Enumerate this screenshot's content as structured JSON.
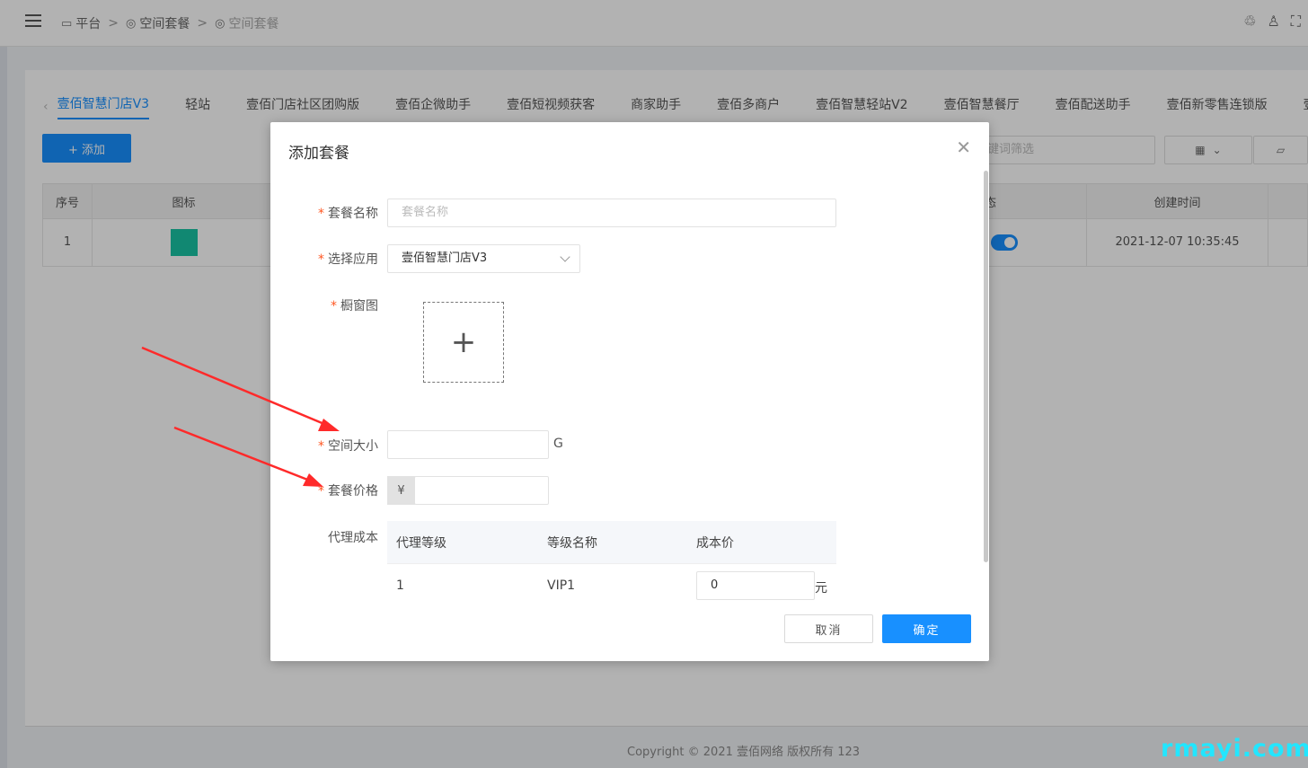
{
  "breadcrumb": [
    "平台",
    "空间套餐",
    "空间套餐"
  ],
  "tabs": [
    "壹佰智慧门店V3",
    "轻站",
    "壹佰门店社区团购版",
    "壹佰企微助手",
    "壹佰短视频获客",
    "商家助手",
    "壹佰多商户",
    "壹佰智慧轻站V2",
    "壹佰智慧餐厅",
    "壹佰配送助手",
    "壹佰新零售连锁版",
    "壹"
  ],
  "toolbar": {
    "add_label": "+ 添加",
    "filter_placeholder": "键词筛选"
  },
  "table": {
    "headers": {
      "index": "序号",
      "icon": "图标",
      "status": "状态",
      "created": "创建时间"
    },
    "rows": [
      {
        "index": "1",
        "icon_color": "#19c3a4",
        "status": "on",
        "created": "2021-12-07 10:35:45"
      }
    ]
  },
  "modal": {
    "title": "添加套餐",
    "fields": {
      "name": {
        "label": "套餐名称",
        "placeholder": "套餐名称",
        "value": ""
      },
      "app": {
        "label": "选择应用",
        "value": "壹佰智慧门店V3"
      },
      "image": {
        "label": "橱窗图"
      },
      "space": {
        "label": "空间大小",
        "unit": "G",
        "value": ""
      },
      "price": {
        "label": "套餐价格",
        "prefix": "¥",
        "value": ""
      },
      "agent": {
        "label": "代理成本",
        "headers": [
          "代理等级",
          "等级名称",
          "成本价"
        ],
        "rows": [
          {
            "level": "1",
            "name": "VIP1",
            "cost": "0",
            "unit": "元"
          }
        ]
      }
    },
    "buttons": {
      "cancel": "取消",
      "ok": "确定"
    }
  },
  "footer": "Copyright © 2021 壹佰网络 版权所有   123",
  "watermark": "rmayi.com",
  "colors": {
    "primary": "#1890ff",
    "required": "#ff5722",
    "arrow": "#ff2a2a"
  }
}
